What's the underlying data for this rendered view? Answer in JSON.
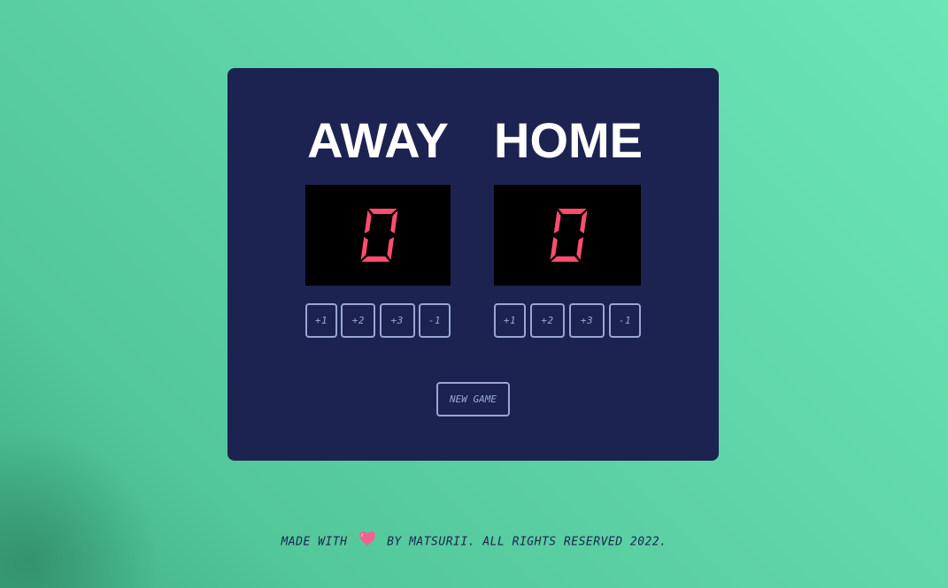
{
  "board": {
    "away": {
      "name": "AWAY",
      "score": "0",
      "buttons": [
        "+1",
        "+2",
        "+3",
        "-1"
      ]
    },
    "home": {
      "name": "HOME",
      "score": "0",
      "buttons": [
        "+1",
        "+2",
        "+3",
        "-1"
      ]
    },
    "new_game_label": "New Game"
  },
  "footer": {
    "prefix": "Made with",
    "icon": "heart-icon",
    "suffix": "by Matsurii. All rights reserved 2022."
  },
  "colors": {
    "background_start": "#3fae84",
    "background_end": "#6ae6b7",
    "board": "#1c2350",
    "score_digit": "#ff4d6d",
    "score_box": "#000000",
    "button_border": "#9aa6d6",
    "heart": "#f06292"
  }
}
